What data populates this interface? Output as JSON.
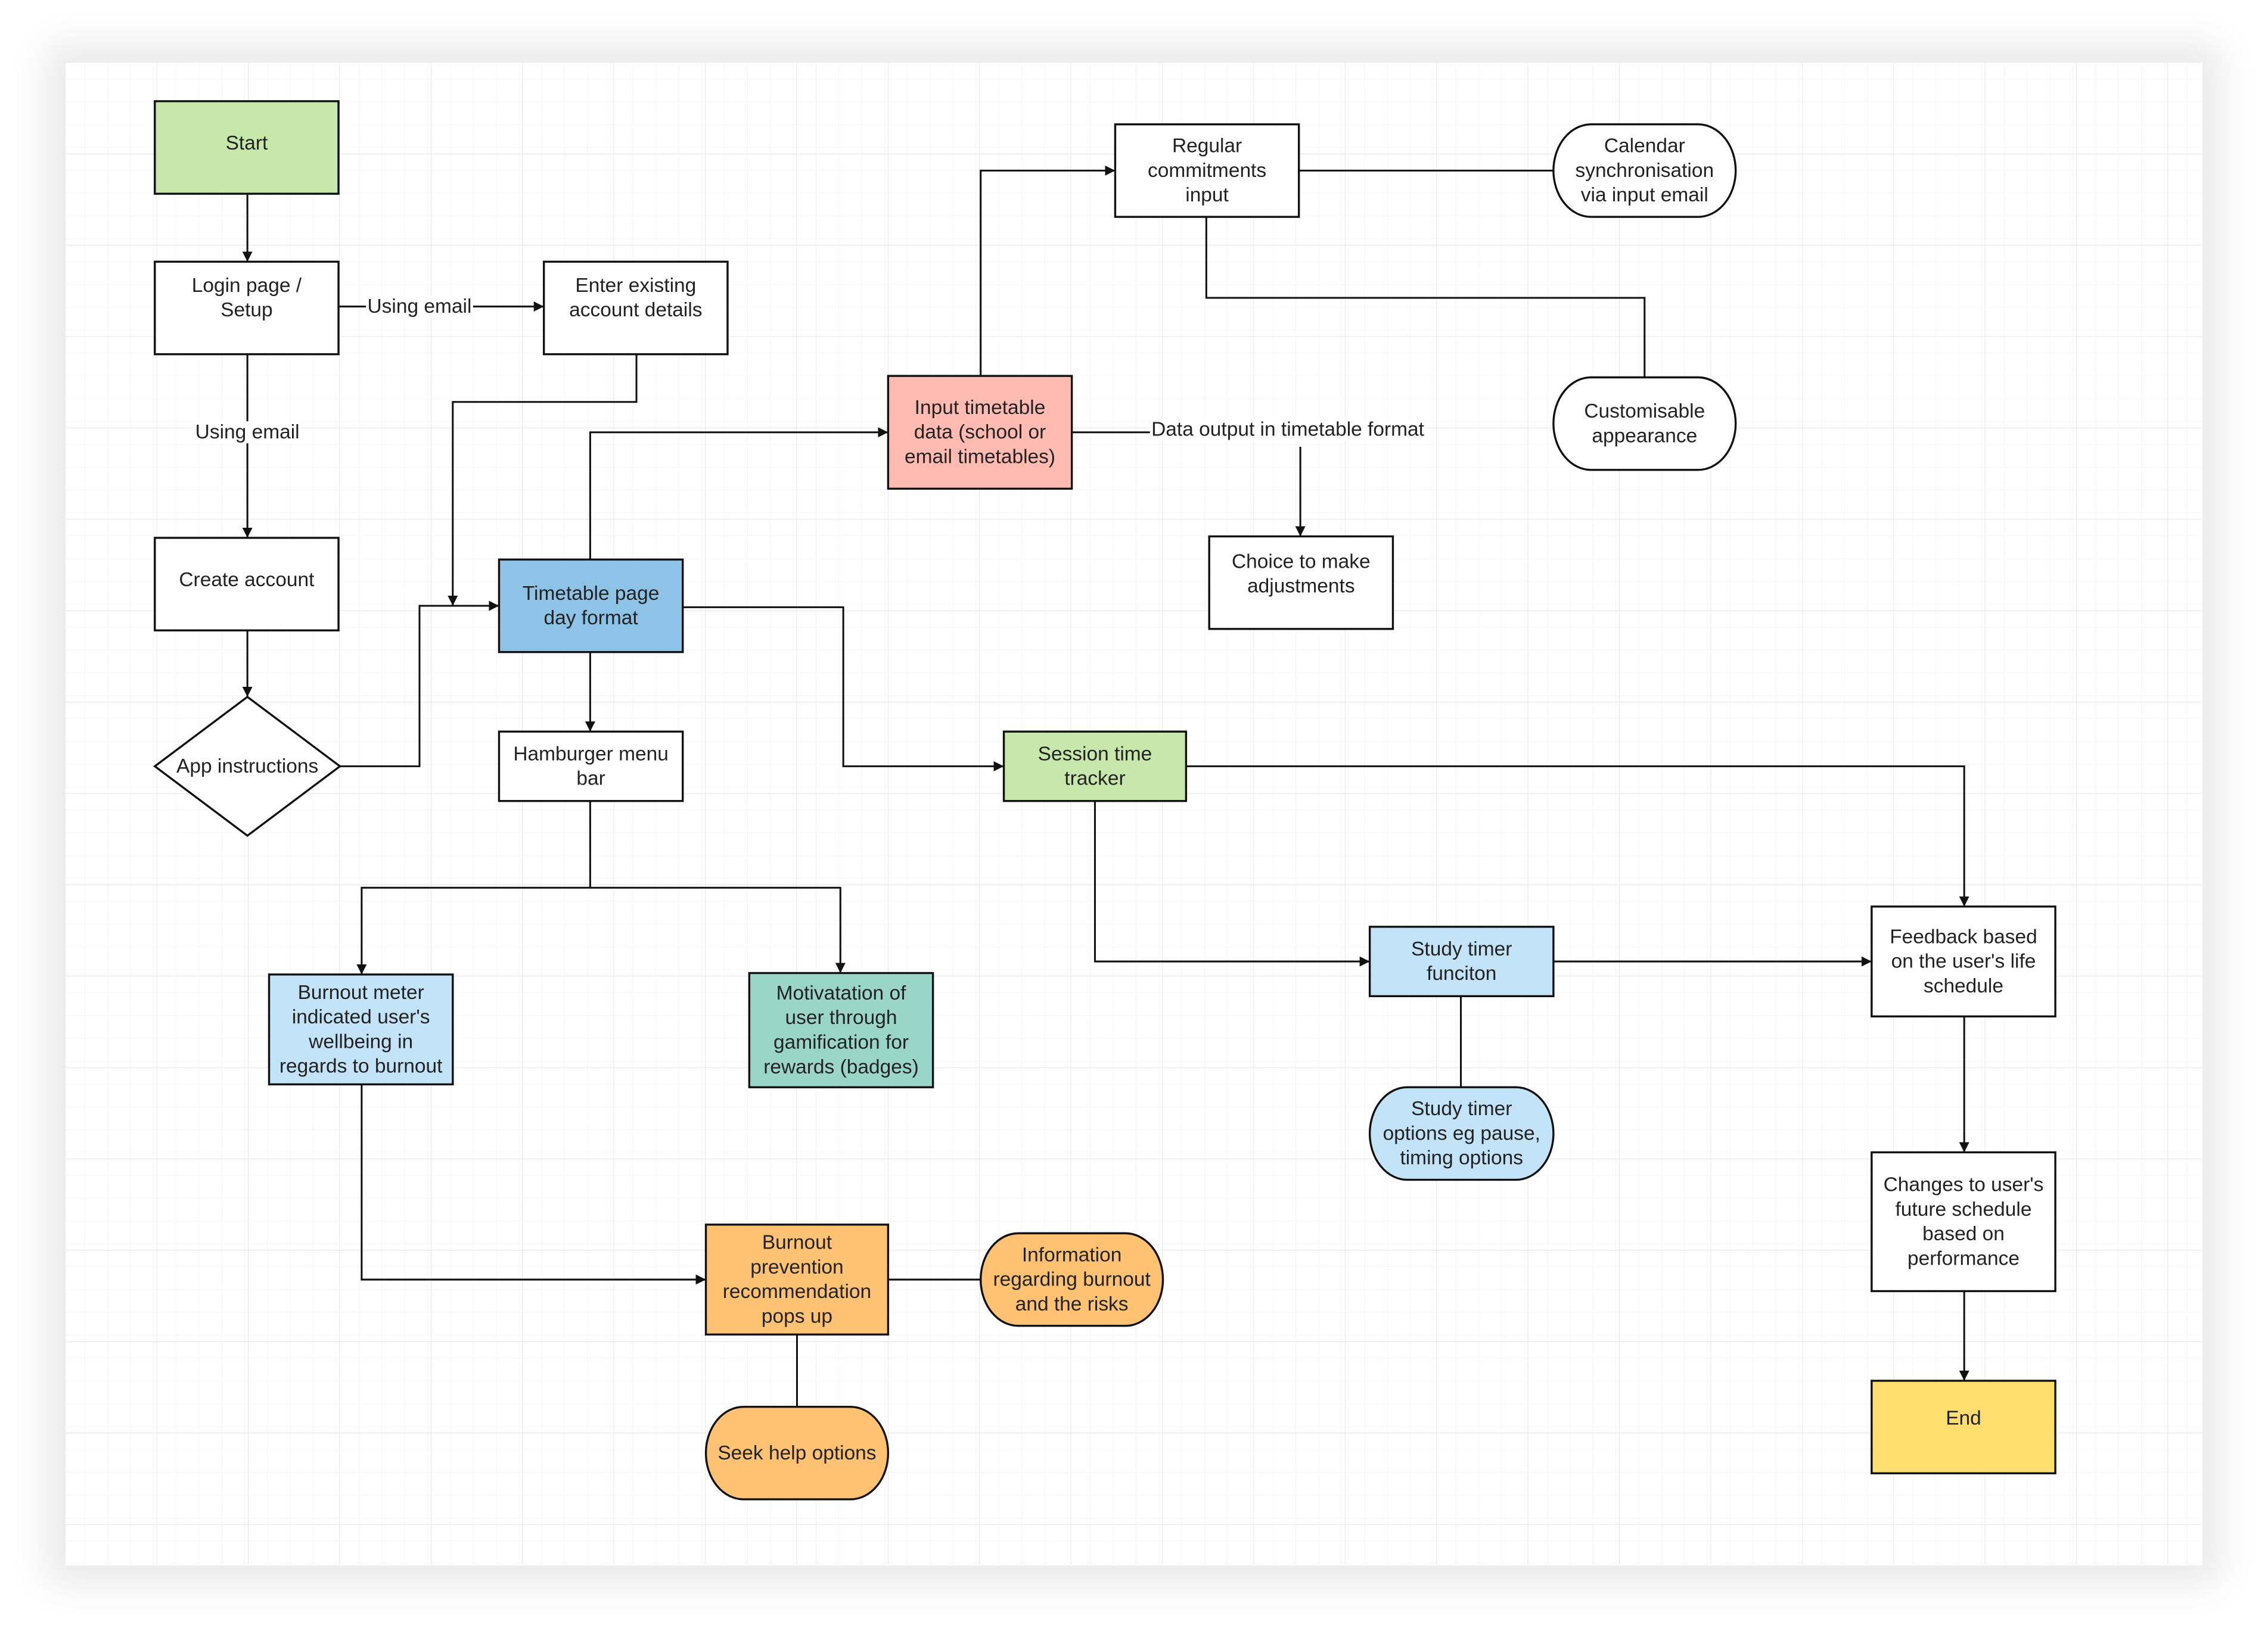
{
  "diagram": {
    "type": "flowchart",
    "colors": {
      "green": "#c7e8aa",
      "blue": "#8ec3e8",
      "light_blue": "#c3e4f8",
      "pink": "#ffbbb1",
      "teal": "#9ad6c8",
      "orange": "#fec272",
      "yellow": "#ffdd6f",
      "white": "#ffffff",
      "stroke": "#111111",
      "grid_minor": "#efefef",
      "grid_major": "#dedede"
    },
    "nodes": [
      {
        "id": "start",
        "shape": "rect",
        "fill": "green",
        "lines": [
          "Start"
        ]
      },
      {
        "id": "login",
        "shape": "rect",
        "fill": "white",
        "lines": [
          "Login page /",
          "Setup"
        ]
      },
      {
        "id": "enter_existing",
        "shape": "rect",
        "fill": "white",
        "lines": [
          "Enter existing",
          "account details"
        ]
      },
      {
        "id": "create_account",
        "shape": "rect",
        "fill": "white",
        "lines": [
          "Create account"
        ]
      },
      {
        "id": "app_instructions",
        "shape": "diamond",
        "fill": "white",
        "lines": [
          "App instructions"
        ]
      },
      {
        "id": "timetable_page",
        "shape": "rect",
        "fill": "blue",
        "lines": [
          "Timetable page",
          "day format"
        ]
      },
      {
        "id": "hamburger",
        "shape": "rect",
        "fill": "white",
        "lines": [
          "Hamburger menu",
          "bar"
        ]
      },
      {
        "id": "input_timetable",
        "shape": "rect",
        "fill": "pink",
        "lines": [
          "Input timetable",
          "data (school or",
          "email timetables)"
        ]
      },
      {
        "id": "regular_commitments",
        "shape": "rect",
        "fill": "white",
        "lines": [
          "Regular",
          "commitments",
          "input"
        ]
      },
      {
        "id": "calendar_sync",
        "shape": "terminator",
        "fill": "white",
        "lines": [
          "Calendar",
          "synchronisation",
          "via input email"
        ]
      },
      {
        "id": "customisable",
        "shape": "terminator",
        "fill": "white",
        "lines": [
          "Customisable",
          "appearance"
        ]
      },
      {
        "id": "choice_adjust",
        "shape": "rect",
        "fill": "white",
        "lines": [
          "Choice to make",
          "adjustments"
        ]
      },
      {
        "id": "session_tracker",
        "shape": "rect",
        "fill": "green",
        "lines": [
          "Session time",
          "tracker"
        ]
      },
      {
        "id": "study_timer",
        "shape": "rect",
        "fill": "light_blue",
        "lines": [
          "Study timer",
          "funciton"
        ]
      },
      {
        "id": "study_options",
        "shape": "terminator",
        "fill": "light_blue",
        "lines": [
          "Study timer",
          "options eg pause,",
          "timing options"
        ]
      },
      {
        "id": "feedback",
        "shape": "rect",
        "fill": "white",
        "lines": [
          "Feedback based",
          "on the user's life",
          "schedule"
        ]
      },
      {
        "id": "changes",
        "shape": "rect",
        "fill": "white",
        "lines": [
          "Changes to user's",
          "future schedule",
          "based on",
          "performance"
        ]
      },
      {
        "id": "end",
        "shape": "rect",
        "fill": "yellow",
        "lines": [
          "End"
        ]
      },
      {
        "id": "burnout_meter",
        "shape": "rect",
        "fill": "light_blue",
        "lines": [
          "Burnout meter",
          "indicated user's",
          "wellbeing in",
          "regards to burnout"
        ]
      },
      {
        "id": "motivation",
        "shape": "rect",
        "fill": "teal",
        "lines": [
          "Motivatation of",
          "user through",
          "gamification  for",
          "rewards (badges)"
        ]
      },
      {
        "id": "burnout_prevention",
        "shape": "rect",
        "fill": "orange",
        "lines": [
          "Burnout",
          "prevention",
          "recommendation",
          "pops up"
        ]
      },
      {
        "id": "burnout_info",
        "shape": "terminator",
        "fill": "orange",
        "lines": [
          "Information",
          "regarding burnout",
          "and the risks"
        ]
      },
      {
        "id": "seek_help",
        "shape": "terminator",
        "fill": "orange",
        "lines": [
          "Seek help options"
        ]
      }
    ],
    "edges": [
      {
        "id": "e1",
        "from": "start",
        "to": "login",
        "arrow": true,
        "label": ""
      },
      {
        "id": "e2",
        "from": "login",
        "to": "enter_existing",
        "arrow": true,
        "label": "Using email"
      },
      {
        "id": "e3",
        "from": "login",
        "to": "create_account",
        "arrow": true,
        "label": "Using email"
      },
      {
        "id": "e4",
        "from": "create_account",
        "to": "app_instructions",
        "arrow": true,
        "label": ""
      },
      {
        "id": "e5",
        "from": "app_instructions",
        "to": "timetable_page",
        "arrow": true,
        "label": ""
      },
      {
        "id": "e6",
        "from": "enter_existing",
        "to": "timetable_page",
        "arrow": true,
        "label": ""
      },
      {
        "id": "e7",
        "from": "timetable_page",
        "to": "input_timetable",
        "arrow": true,
        "label": ""
      },
      {
        "id": "e8",
        "from": "input_timetable",
        "to": "regular_commitments",
        "arrow": true,
        "label": ""
      },
      {
        "id": "e9",
        "from": "regular_commitments",
        "to": "calendar_sync",
        "arrow": false,
        "label": ""
      },
      {
        "id": "e10",
        "from": "regular_commitments",
        "to": "customisable",
        "arrow": false,
        "label": ""
      },
      {
        "id": "e11",
        "from": "input_timetable",
        "to": "choice_adjust",
        "arrow": true,
        "label": "Data output in timetable format"
      },
      {
        "id": "e12",
        "from": "timetable_page",
        "to": "hamburger",
        "arrow": true,
        "label": ""
      },
      {
        "id": "e13",
        "from": "timetable_page",
        "to": "session_tracker",
        "arrow": true,
        "label": ""
      },
      {
        "id": "e14",
        "from": "hamburger",
        "to": "burnout_meter",
        "arrow": true,
        "label": ""
      },
      {
        "id": "e15",
        "from": "hamburger",
        "to": "motivation",
        "arrow": true,
        "label": ""
      },
      {
        "id": "e16",
        "from": "session_tracker",
        "to": "study_timer",
        "arrow": true,
        "label": ""
      },
      {
        "id": "e17",
        "from": "session_tracker",
        "to": "feedback",
        "arrow": true,
        "label": ""
      },
      {
        "id": "e18",
        "from": "study_timer",
        "to": "feedback",
        "arrow": true,
        "label": ""
      },
      {
        "id": "e19",
        "from": "study_timer",
        "to": "study_options",
        "arrow": false,
        "label": ""
      },
      {
        "id": "e20",
        "from": "feedback",
        "to": "changes",
        "arrow": true,
        "label": ""
      },
      {
        "id": "e21",
        "from": "changes",
        "to": "end",
        "arrow": true,
        "label": ""
      },
      {
        "id": "e22",
        "from": "burnout_meter",
        "to": "burnout_prevention",
        "arrow": true,
        "label": ""
      },
      {
        "id": "e23",
        "from": "burnout_prevention",
        "to": "burnout_info",
        "arrow": false,
        "label": ""
      },
      {
        "id": "e24",
        "from": "burnout_prevention",
        "to": "seek_help",
        "arrow": false,
        "label": ""
      }
    ]
  }
}
